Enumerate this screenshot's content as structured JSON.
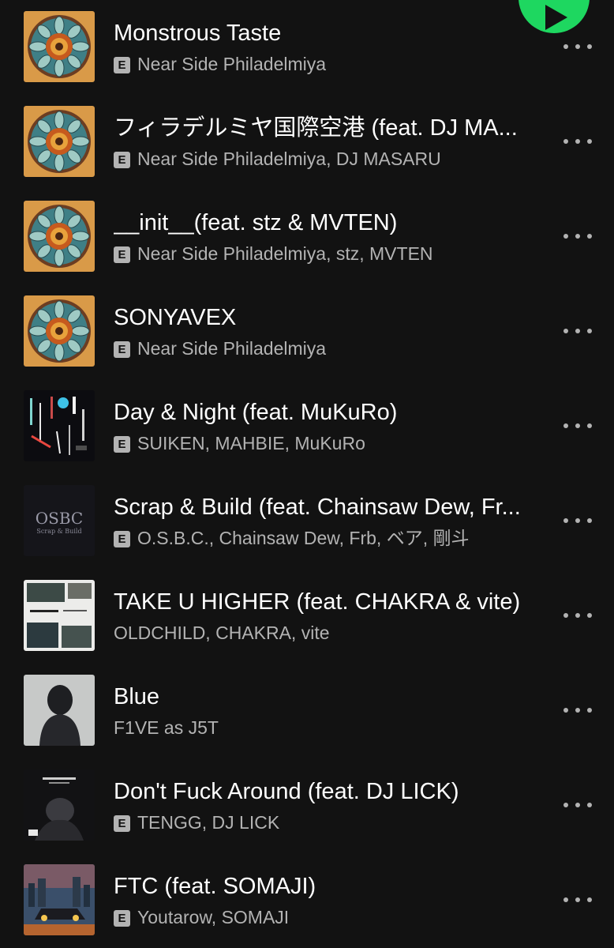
{
  "colors": {
    "background": "#121212",
    "title": "#ffffff",
    "subtitle": "#b3b3b3",
    "accent": "#1ed760"
  },
  "play_button": {
    "icon": "play-icon"
  },
  "tracks": [
    {
      "title": "Monstrous Taste",
      "explicit": true,
      "explicit_label": "E",
      "artists": "Near Side Philadelmiya",
      "cover": "mandala-cover-art",
      "more_icon": "more-options-icon"
    },
    {
      "title": "フィラデルミヤ国際空港 (feat. DJ MA...",
      "explicit": true,
      "explicit_label": "E",
      "artists": "Near Side Philadelmiya, DJ MASARU",
      "cover": "mandala-cover-art",
      "more_icon": "more-options-icon"
    },
    {
      "title": "__init__(feat. stz & MVTEN)",
      "explicit": true,
      "explicit_label": "E",
      "artists": "Near Side Philadelmiya, stz, MVTEN",
      "cover": "mandala-cover-art",
      "more_icon": "more-options-icon"
    },
    {
      "title": "SONYAVEX",
      "explicit": true,
      "explicit_label": "E",
      "artists": "Near Side Philadelmiya",
      "cover": "mandala-cover-art",
      "more_icon": "more-options-icon"
    },
    {
      "title": "Day & Night (feat. MuKuRo)",
      "explicit": true,
      "explicit_label": "E",
      "artists": "SUIKEN, MAHBIE, MuKuRo",
      "cover": "neon-night-cover-art",
      "more_icon": "more-options-icon"
    },
    {
      "title": "Scrap & Build (feat. Chainsaw Dew, Fr...",
      "explicit": true,
      "explicit_label": "E",
      "artists": "O.S.B.C., Chainsaw Dew, Frb, ベア, 剛斗",
      "cover": "osbc-cover-art",
      "cover_text": "OSBC",
      "cover_subtext": "Scrap & Build",
      "more_icon": "more-options-icon"
    },
    {
      "title": "TAKE U HIGHER (feat. CHAKRA & vite)",
      "explicit": false,
      "explicit_label": "",
      "artists": "OLDCHILD, CHAKRA, vite",
      "cover": "photo-collage-cover-art",
      "more_icon": "more-options-icon"
    },
    {
      "title": "Blue",
      "explicit": false,
      "explicit_label": "",
      "artists": "F1VE as J5T",
      "cover": "hooded-figure-cover-art",
      "more_icon": "more-options-icon"
    },
    {
      "title": "Don't Fuck Around (feat. DJ LICK)",
      "explicit": true,
      "explicit_label": "E",
      "artists": "TENGG, DJ LICK",
      "cover": "dark-portrait-cover-art",
      "more_icon": "more-options-icon"
    },
    {
      "title": "FTC (feat. SOMAJI)",
      "explicit": true,
      "explicit_label": "E",
      "artists": "Youtarow, SOMAJI",
      "cover": "city-car-cover-art",
      "more_icon": "more-options-icon"
    }
  ]
}
